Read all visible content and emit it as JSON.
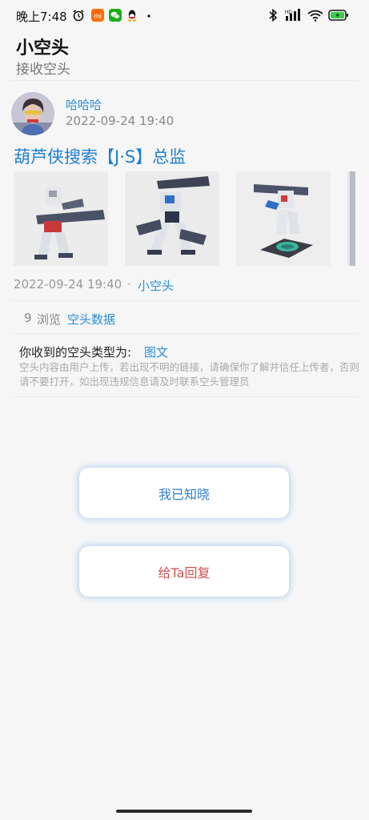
{
  "status_bar": {
    "time": "晚上7:48",
    "icons": [
      "alarm-icon",
      "mi-app-icon",
      "wechat-icon",
      "qq-icon",
      "dot-icon",
      "bluetooth-icon",
      "signal-hd-icon",
      "wifi-icon",
      "battery-charging-icon"
    ]
  },
  "header": {
    "title": "小空头",
    "subtitle": "接收空头"
  },
  "sender": {
    "name": "哈哈哈",
    "time": "2022-09-24 19:40"
  },
  "post": {
    "title": "葫芦侠搜索【J·S】总监",
    "images": [
      "gundam-figure-1",
      "gundam-figure-2",
      "gundam-figure-3",
      "gundam-figure-4"
    ],
    "time": "2022-09-24 19:40",
    "dot": "·",
    "author": "小空头"
  },
  "stats": {
    "views": "9",
    "views_label": "浏览",
    "data_link": "空头数据"
  },
  "type_info": {
    "label": "你收到的空头类型为:",
    "value": "图文",
    "notice": "空头内容由用户上传，若出现不明的链接，请确保你了解并信任上传者，否则请不要打开，如出现违规信息请及时联系空头管理员"
  },
  "buttons": {
    "acknowledge": "我已知晓",
    "reply": "给Ta回复"
  },
  "colors": {
    "accent": "#2a8ed6",
    "reply": "#d55050",
    "background": "#f6f6f6"
  }
}
